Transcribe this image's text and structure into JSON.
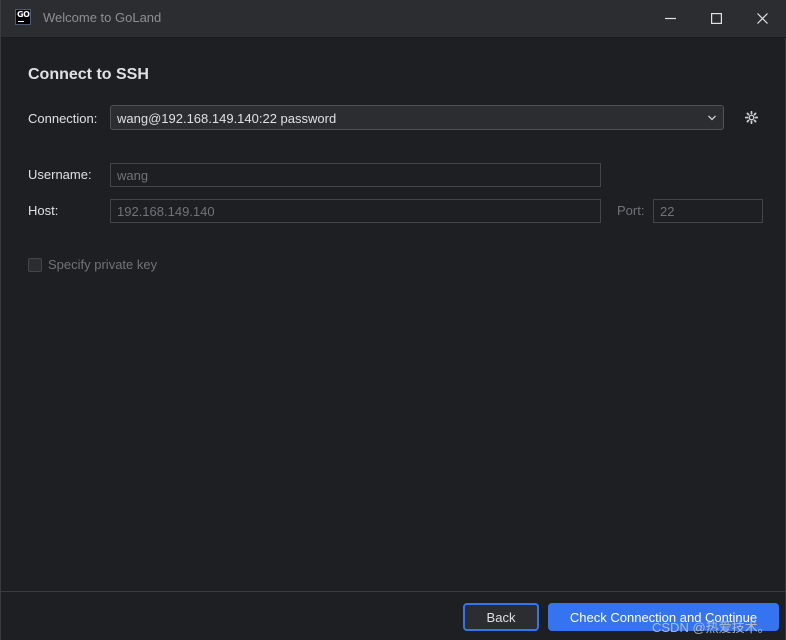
{
  "window": {
    "title": "Welcome to GoLand",
    "logo_text": "GO"
  },
  "page": {
    "heading": "Connect to SSH"
  },
  "connection": {
    "label": "Connection:",
    "value": "wang@192.168.149.140:22 password",
    "arrow_icon": "chevron-down-icon",
    "settings_icon": "gear-icon"
  },
  "username": {
    "label": "Username:",
    "value": "wang"
  },
  "host": {
    "label": "Host:",
    "value": "192.168.149.140"
  },
  "port": {
    "label": "Port:",
    "value": "22"
  },
  "private_key": {
    "label": "Specify private key",
    "checked": false
  },
  "footer": {
    "back_label": "Back",
    "continue_label": "Check Connection and Continue"
  },
  "watermark": "CSDN @热爱技术。",
  "colors": {
    "background": "#1e1f22",
    "accent": "#3574f0",
    "text": "#dfe1e5",
    "disabled_text": "#6f737a"
  }
}
